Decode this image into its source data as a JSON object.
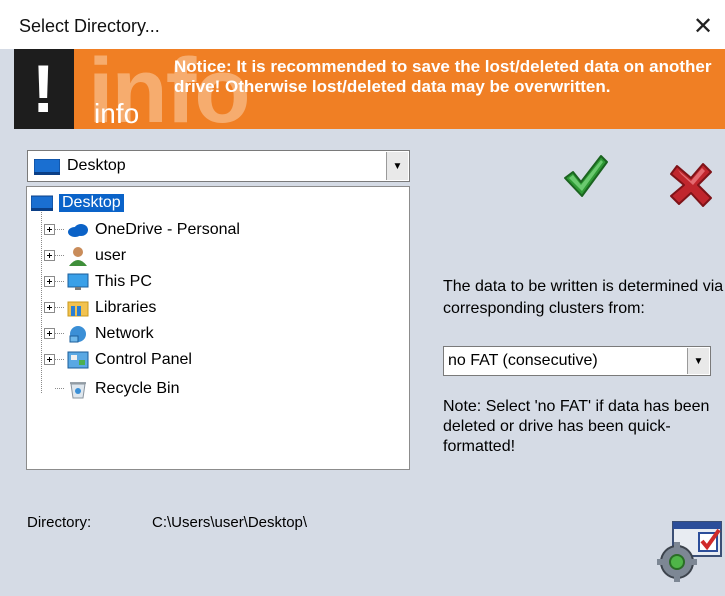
{
  "window": {
    "title": "Select Directory...",
    "close_glyph": "✕"
  },
  "banner": {
    "logo_glyph": "!",
    "logo_big": "info",
    "logo_word": "info",
    "notice": "Notice: It is recommended to save the lost/deleted data on another drive! Otherwise lost/deleted data may be overwritten."
  },
  "drive_selector": {
    "value": "Desktop",
    "icon": "desktop-icon",
    "arrow": "▼"
  },
  "tree": {
    "root": {
      "label": "Desktop",
      "icon": "desktop-icon"
    },
    "items": [
      {
        "label": "OneDrive - Personal",
        "icon": "cloud-icon",
        "expandable": true
      },
      {
        "label": "user",
        "icon": "user-icon",
        "expandable": true
      },
      {
        "label": "This PC",
        "icon": "computer-icon",
        "expandable": true
      },
      {
        "label": "Libraries",
        "icon": "folder-icon",
        "expandable": true
      },
      {
        "label": "Network",
        "icon": "network-icon",
        "expandable": true
      },
      {
        "label": "Control Panel",
        "icon": "control-panel-icon",
        "expandable": true
      },
      {
        "label": "Recycle Bin",
        "icon": "recycle-bin-icon",
        "expandable": false
      }
    ]
  },
  "actions": {
    "ok_icon": "checkmark-icon",
    "cancel_icon": "x-icon",
    "settings_icon": "settings-icon"
  },
  "clusters": {
    "label": "The data to be written is determined via corresponding clusters from:",
    "selected": "no FAT (consecutive)",
    "arrow": "▼",
    "note": "Note: Select 'no FAT' if data has been deleted or drive has been quick-formatted!"
  },
  "directory": {
    "label": "Directory:",
    "value": "C:\\Users\\user\\Desktop\\"
  },
  "colors": {
    "banner": "#f07f24",
    "window_bg": "#d5dbe5",
    "selection": "#0a63c9",
    "ok_green": "#2f9a35",
    "cancel_red": "#c0262d"
  }
}
